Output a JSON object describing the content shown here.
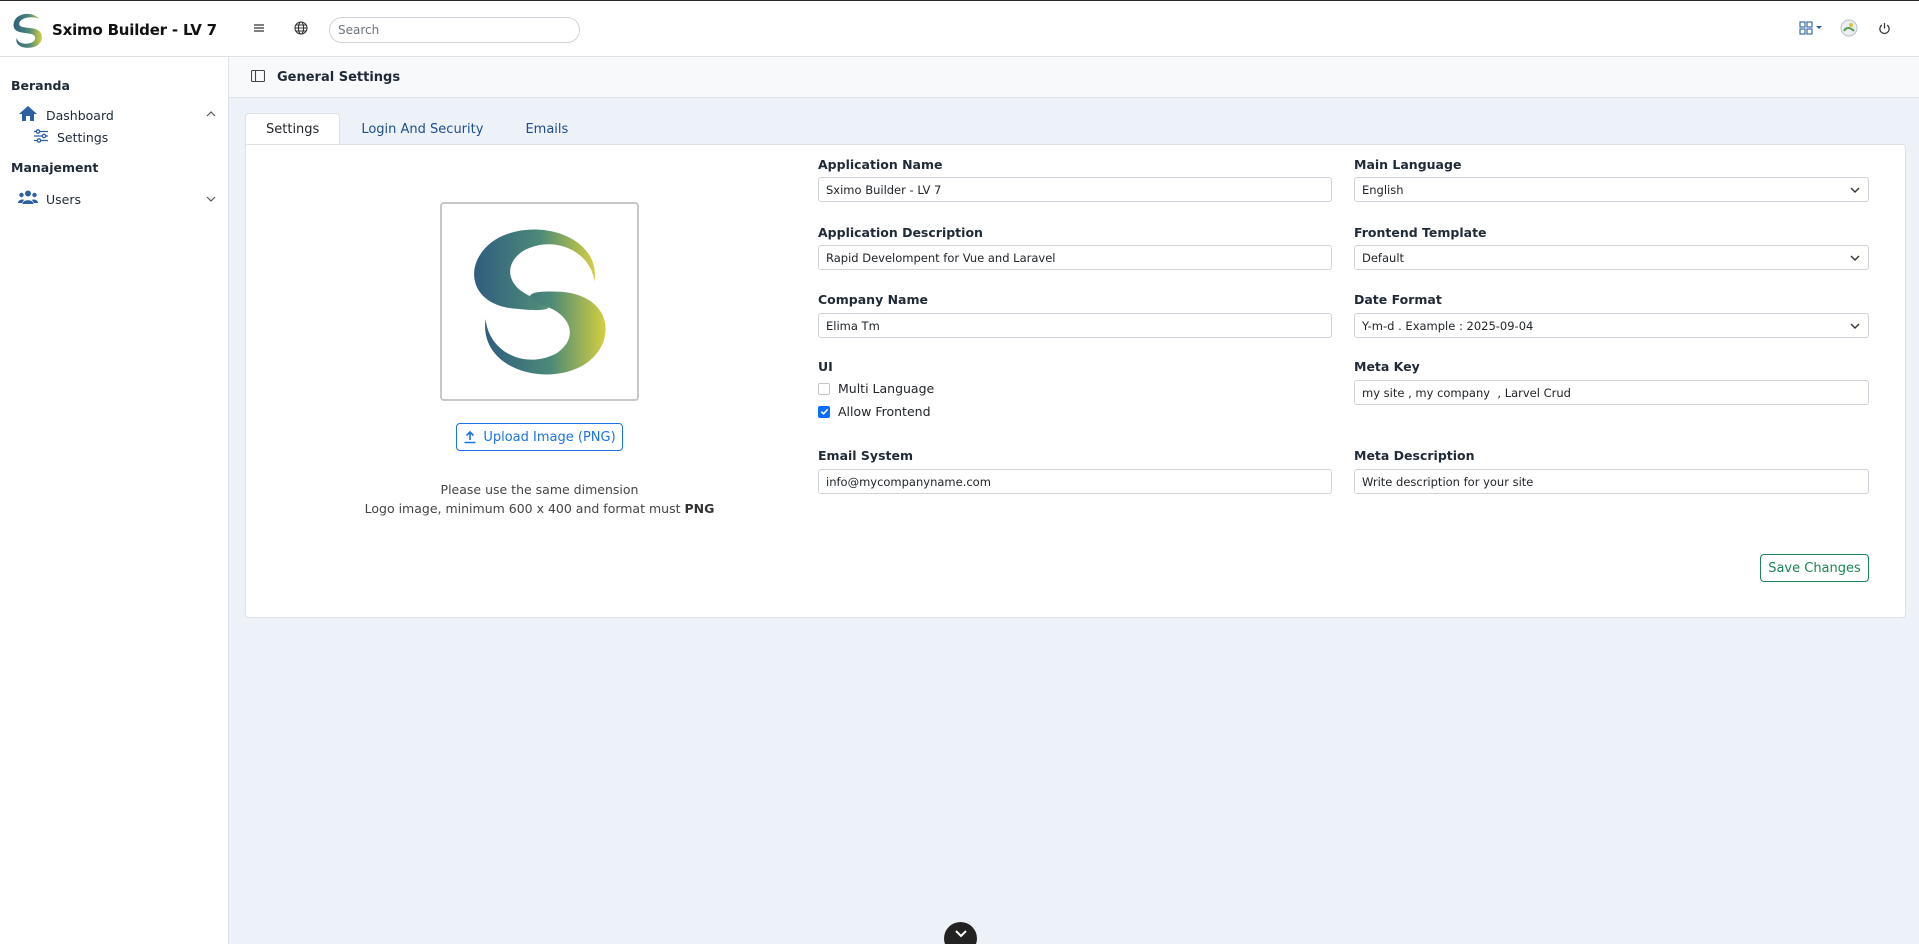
{
  "app": {
    "title": "Sximo Builder - LV 7",
    "accent_color": "#1a73e8"
  },
  "topbar": {
    "menu_icon": "hamburger-icon",
    "language_icon": "globe-icon",
    "search_placeholder": "Search",
    "apps_icon": "apps-grid-icon",
    "avatar_icon": "avatar-icon",
    "power_icon": "power-icon"
  },
  "sidebar": {
    "sections": [
      {
        "header": "Beranda",
        "items": [
          {
            "label": "Dashboard",
            "icon": "home-icon",
            "expanded": true,
            "children": [
              {
                "label": "Settings",
                "icon": "sliders-icon"
              }
            ]
          }
        ]
      },
      {
        "header": "Manajement",
        "items": [
          {
            "label": "Users",
            "icon": "users-icon",
            "expanded": false
          }
        ]
      }
    ]
  },
  "page": {
    "title": "General Settings"
  },
  "tabs": [
    {
      "label": "Settings",
      "active": true
    },
    {
      "label": "Login And Security",
      "active": false
    },
    {
      "label": "Emails",
      "active": false
    }
  ],
  "logo_panel": {
    "upload_label": "Upload Image (PNG)",
    "note_line1": "Please use the same dimension",
    "note_line2_prefix": "Logo image, minimum 600 x 400 and format must ",
    "note_line2_bold": "PNG"
  },
  "form": {
    "app_name": {
      "label": "Application Name",
      "value": "Sximo Builder - LV 7"
    },
    "app_description": {
      "label": "Application Description",
      "value": "Rapid Develompent for Vue and Laravel"
    },
    "company_name": {
      "label": "Company Name",
      "value": "Elima Tm"
    },
    "ui": {
      "label": "UI",
      "options": [
        {
          "label": "Multi Language",
          "checked": false
        },
        {
          "label": "Allow Frontend",
          "checked": true
        }
      ]
    },
    "email_system": {
      "label": "Email System",
      "value": "info@mycompanyname.com"
    },
    "main_language": {
      "label": "Main Language",
      "value": "English"
    },
    "frontend_template": {
      "label": "Frontend Template",
      "value": "Default"
    },
    "date_format": {
      "label": "Date Format",
      "value": "Y-m-d . Example : 2025-09-04"
    },
    "meta_key": {
      "label": "Meta Key",
      "value": "my site , my company  , Larvel Crud"
    },
    "meta_description": {
      "label": "Meta Description",
      "value": "Write description for your site"
    },
    "save_label": "Save Changes"
  },
  "footer_badge": {
    "icon": "chevron-down-icon"
  }
}
